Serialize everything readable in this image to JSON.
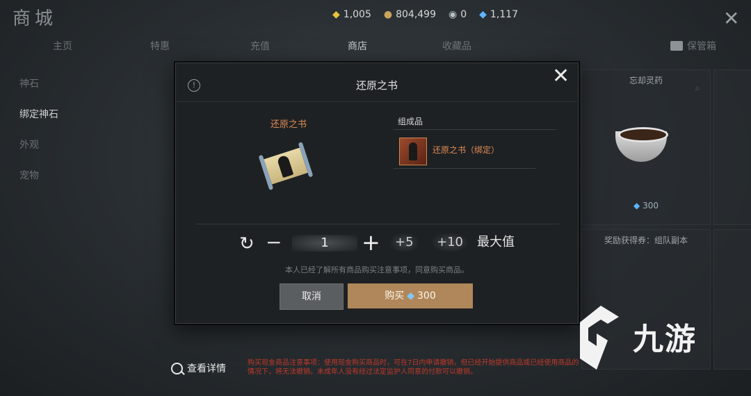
{
  "header": {
    "title": "商城",
    "currencies": [
      {
        "icon": "gold-diamond-icon",
        "value": "1,005"
      },
      {
        "icon": "coin-pile-icon",
        "value": "804,499"
      },
      {
        "icon": "silver-coin-icon",
        "value": "0"
      },
      {
        "icon": "blue-gem-icon",
        "value": "1,117"
      }
    ]
  },
  "tabs": [
    {
      "label": "主页"
    },
    {
      "label": "特惠"
    },
    {
      "label": "充值"
    },
    {
      "label": "商店",
      "active": true
    },
    {
      "label": "收藏品"
    },
    {
      "label": "保管箱"
    }
  ],
  "sidebar": {
    "items": [
      {
        "label": "神石"
      },
      {
        "label": "绑定神石",
        "selected": true
      },
      {
        "label": "外观"
      },
      {
        "label": "宠物"
      }
    ]
  },
  "bg_cards": {
    "right_top": {
      "title": "忘却灵药",
      "price": "300"
    },
    "right_bottom": {
      "title": "奖励获得券：组队副本"
    }
  },
  "modal": {
    "title": "还原之书",
    "item_name": "还原之书",
    "component_label": "组成品",
    "component_name": "还原之书（绑定）",
    "quantity": "1",
    "step_plus5": "+5",
    "step_plus10": "+10",
    "max_label": "最大值",
    "agree_text": "本人已经了解所有商品购买注意事项，同意购买商品。",
    "cancel_label": "取消",
    "buy_label": "购买",
    "buy_price": "300"
  },
  "footer": {
    "detail_label": "查看详情",
    "notice_line1": "购买现金商品注意事项：使用现金购买商品时，可在7日内申请撤销，但已经开始提供商品或已经使用商品的",
    "notice_line2": "情况下，将无法撤销。未成年人没有经过法定监护人同意的付款可以撤销。"
  },
  "watermark": {
    "text": "九游"
  }
}
